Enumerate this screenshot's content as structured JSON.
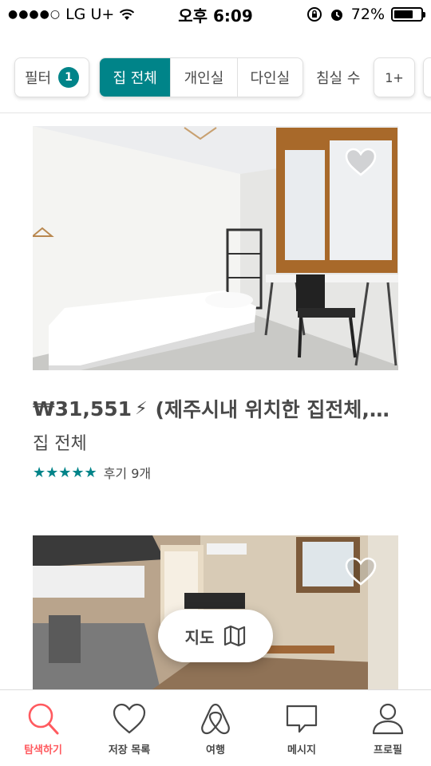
{
  "status_bar": {
    "carrier": "LG U+",
    "time": "오후 6:09",
    "battery": "72%",
    "battery_level": 0.72
  },
  "filters": {
    "filter_label": "필터",
    "filter_count": "1",
    "room_types": [
      "집 전체",
      "개인실",
      "다인실"
    ],
    "active_room_type": "집 전체",
    "beds_label": "침실 수",
    "bed_option": "1+"
  },
  "listings": [
    {
      "price": "₩31,551",
      "title": "(제주시내 위치한 집전체,…",
      "room_type": "집 전체",
      "stars": 5,
      "reviews": "후기 9개",
      "instant_book": true
    },
    {
      "price": "",
      "title": "",
      "room_type": "",
      "instant_book": false
    }
  ],
  "map_button": {
    "label": "지도"
  },
  "tabs": [
    {
      "label": "탐색하기",
      "icon": "search-icon",
      "active": true
    },
    {
      "label": "저장 목록",
      "icon": "heart-icon",
      "active": false
    },
    {
      "label": "여행",
      "icon": "airbnb-logo-icon",
      "active": false
    },
    {
      "label": "메시지",
      "icon": "message-icon",
      "active": false
    },
    {
      "label": "프로필",
      "icon": "profile-icon",
      "active": false
    }
  ],
  "colors": {
    "accent": "#008489",
    "active_tab": "#ff5a5f",
    "text": "#484848"
  }
}
